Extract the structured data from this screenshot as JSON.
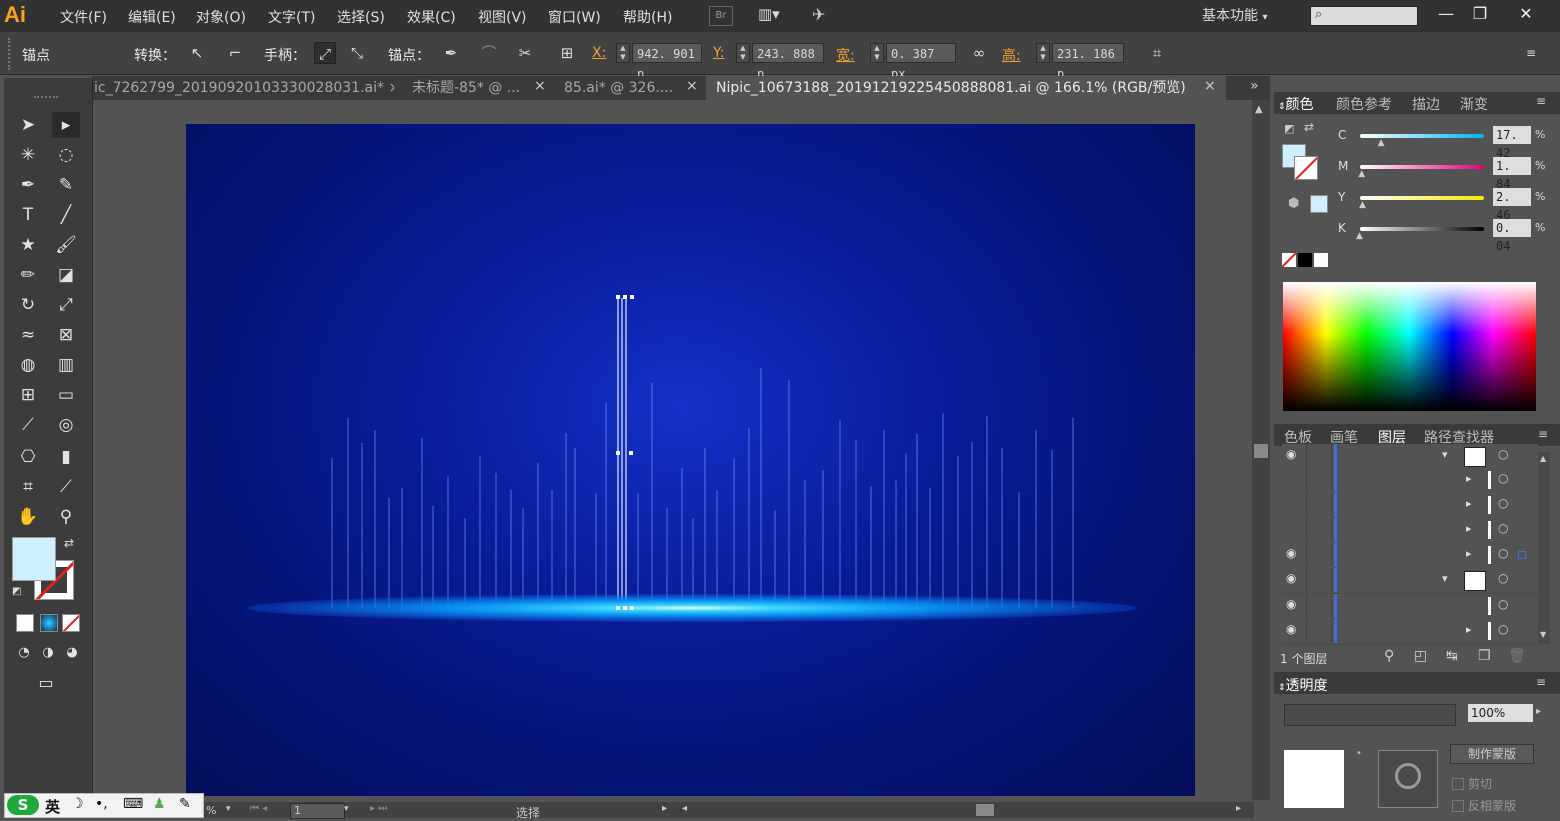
{
  "app": {
    "logo": "Ai"
  },
  "menu": [
    "文件(F)",
    "编辑(E)",
    "对象(O)",
    "文字(T)",
    "选择(S)",
    "效果(C)",
    "视图(V)",
    "窗口(W)",
    "帮助(H)"
  ],
  "menubar": {
    "bridge_label": "Br",
    "workspace": "基本功能"
  },
  "control": {
    "selection_label": "锚点",
    "convert_label": "转换：",
    "handles_label": "手柄：",
    "anchors_label": "锚点：",
    "x_label": "X:",
    "x_value": "942. 901 p",
    "y_label": "Y:",
    "y_value": "243. 888 p",
    "w_label": "宽:",
    "w_value": "0. 387  px",
    "h_label": "高:",
    "h_value": "231. 186 p"
  },
  "tabs": [
    {
      "label": "ic_7262799_20190920103330028031.ai* ×"
    },
    {
      "label": "未标题-85* @ ..."
    },
    {
      "label": "85.ai* @ 326...."
    },
    {
      "label": "Nipic_10673188_20191219225450888081.ai @ 166.1% (RGB/预览)"
    }
  ],
  "color_panel": {
    "tabs": [
      "颜色",
      "颜色参考",
      "描边",
      "渐变"
    ],
    "channels": [
      {
        "label": "C",
        "value": "17. 42",
        "fraction": 0.1742
      },
      {
        "label": "M",
        "value": "1. 84",
        "fraction": 0.0184
      },
      {
        "label": "Y",
        "value": "2. 46",
        "fraction": 0.0246
      },
      {
        "label": "K",
        "value": "0. 04",
        "fraction": 0.0004
      }
    ],
    "percent": "%"
  },
  "layers_panel": {
    "tabs": [
      "色板",
      "画笔",
      "图层",
      "路径查找器"
    ],
    "footer": "1 个图层"
  },
  "transparency_panel": {
    "title": "透明度",
    "opacity": "100%",
    "btn_make_mask": "制作蒙版",
    "clip": "剪切",
    "invert": "反相蒙版"
  },
  "status": {
    "zoom": "%",
    "page": "1",
    "mode": "选择"
  },
  "ime": {
    "lang": "英"
  },
  "colors": {
    "accent": "#f7a21b",
    "canvas_dark": "#040e58",
    "canvas_center": "#1432c8",
    "glow": "#38d4ff",
    "fill_swatch": "#cdefff"
  }
}
